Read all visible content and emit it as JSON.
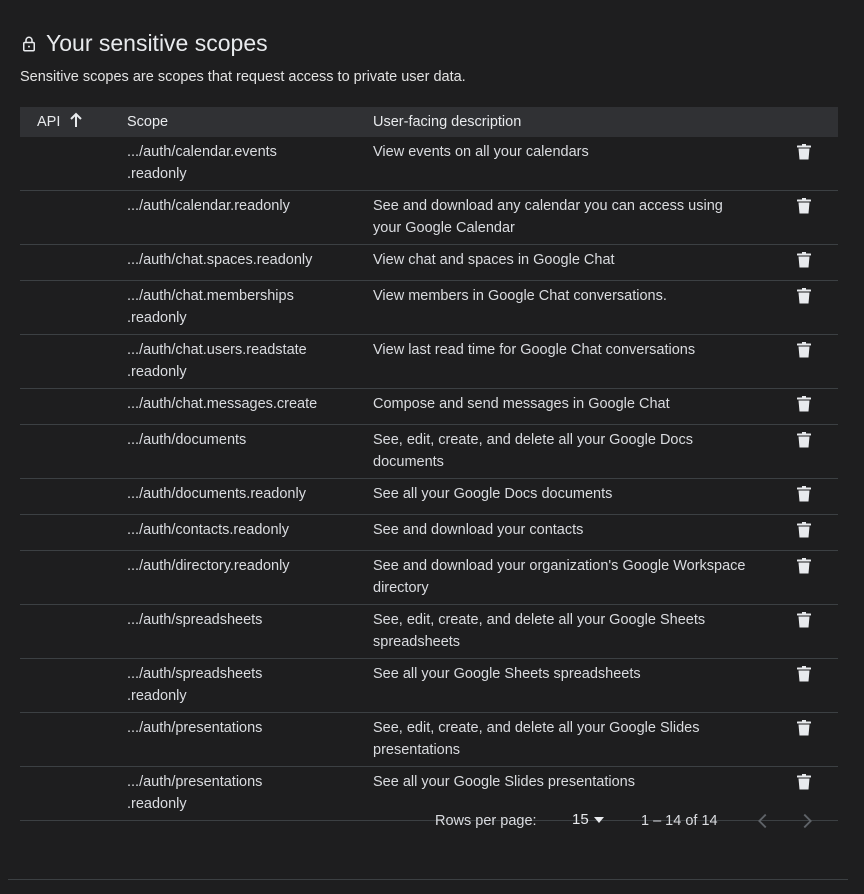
{
  "header": {
    "title": "Your sensitive scopes",
    "subtitle": "Sensitive scopes are scopes that request access to private user data."
  },
  "table": {
    "columns": {
      "api": "API",
      "scope": "Scope",
      "description": "User-facing description"
    },
    "rows": [
      {
        "api": "",
        "scope": ".../auth/calendar.events\n.readonly",
        "description": "View events on all your calendars"
      },
      {
        "api": "",
        "scope": ".../auth/calendar.readonly",
        "description": "See and download any calendar you can access using your Google Calendar"
      },
      {
        "api": "",
        "scope": ".../auth/chat.spaces.readonly",
        "description": "View chat and spaces in Google Chat"
      },
      {
        "api": "",
        "scope": ".../auth/chat.memberships\n.readonly",
        "description": "View members in Google Chat conversations."
      },
      {
        "api": "",
        "scope": ".../auth/chat.users.readstate\n.readonly",
        "description": "View last read time for Google Chat conversations"
      },
      {
        "api": "",
        "scope": ".../auth/chat.messages.create",
        "description": "Compose and send messages in Google Chat"
      },
      {
        "api": "",
        "scope": ".../auth/documents",
        "description": "See, edit, create, and delete all your Google Docs documents"
      },
      {
        "api": "",
        "scope": ".../auth/documents.readonly",
        "description": "See all your Google Docs documents"
      },
      {
        "api": "",
        "scope": ".../auth/contacts.readonly",
        "description": "See and download your contacts"
      },
      {
        "api": "",
        "scope": ".../auth/directory.readonly",
        "description": "See and download your organization's Google Workspace directory"
      },
      {
        "api": "",
        "scope": ".../auth/spreadsheets",
        "description": "See, edit, create, and delete all your Google Sheets spreadsheets"
      },
      {
        "api": "",
        "scope": ".../auth/spreadsheets\n.readonly",
        "description": "See all your Google Sheets spreadsheets"
      },
      {
        "api": "",
        "scope": ".../auth/presentations",
        "description": "See, edit, create, and delete all your Google Slides presentations"
      },
      {
        "api": "",
        "scope": ".../auth/presentations\n.readonly",
        "description": "See all your Google Slides presentations"
      }
    ]
  },
  "pagination": {
    "rows_per_page_label": "Rows per page:",
    "rows_per_page_value": "15",
    "range": "1 – 14 of 14"
  },
  "icons": {
    "title": "lock-icon",
    "sort": "arrow-up-icon",
    "row_action": "trash-icon",
    "dropdown": "caret-down-icon",
    "prev": "chevron-left-icon",
    "next": "chevron-right-icon"
  },
  "colors": {
    "background": "#1e1e1f",
    "header_bg": "#303134",
    "divider": "#3c4043",
    "text": "#e3e3e3",
    "disabled": "#5f6368"
  }
}
